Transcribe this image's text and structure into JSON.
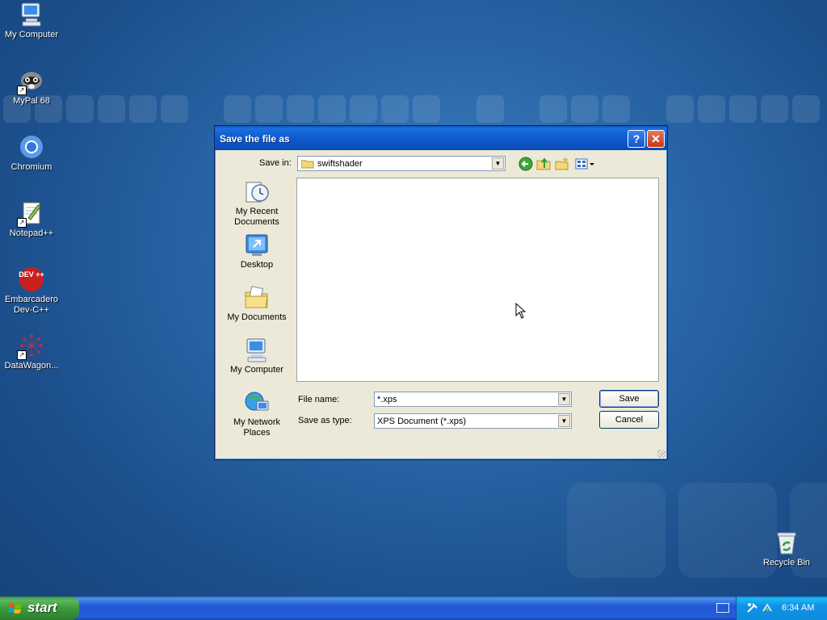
{
  "desktop": {
    "icons": [
      {
        "label": "My Computer",
        "icon": "my-computer-icon"
      },
      {
        "label": "MyPal 68",
        "icon": "mypal-icon"
      },
      {
        "label": "Chromium",
        "icon": "chromium-icon"
      },
      {
        "label": "Notepad++",
        "icon": "notepadpp-icon"
      },
      {
        "label": "Embarcadero Dev-C++",
        "icon": "devcpp-icon",
        "badge": "DEV ++"
      },
      {
        "label": "DataWagon...",
        "icon": "datawagon-icon"
      },
      {
        "label": "Recycle Bin",
        "icon": "recycle-bin-icon"
      }
    ]
  },
  "dialog": {
    "title": "Save the file as",
    "help_glyph": "?",
    "close_glyph": "✕",
    "save_in_label": "Save in:",
    "save_in_value": "swiftshader",
    "places": [
      {
        "label": "My Recent Documents",
        "icon": "recent-documents-icon"
      },
      {
        "label": "Desktop",
        "icon": "desktop-icon"
      },
      {
        "label": "My Documents",
        "icon": "my-documents-icon"
      },
      {
        "label": "My Computer",
        "icon": "my-computer-icon"
      },
      {
        "label": "My Network Places",
        "icon": "network-places-icon"
      }
    ],
    "file_name_label": "File name:",
    "file_name_value": "*.xps",
    "save_as_type_label": "Save as type:",
    "save_as_type_value": "XPS Document (*.xps)",
    "save_button": "Save",
    "cancel_button": "Cancel"
  },
  "taskbar": {
    "start_label": "start",
    "clock": "6:34 AM"
  },
  "colors": {
    "titlebar": "#0e5bd0",
    "dialog_bg": "#ece9d8",
    "start_green": "#3c9b3c",
    "tray_blue": "#1290e8"
  }
}
